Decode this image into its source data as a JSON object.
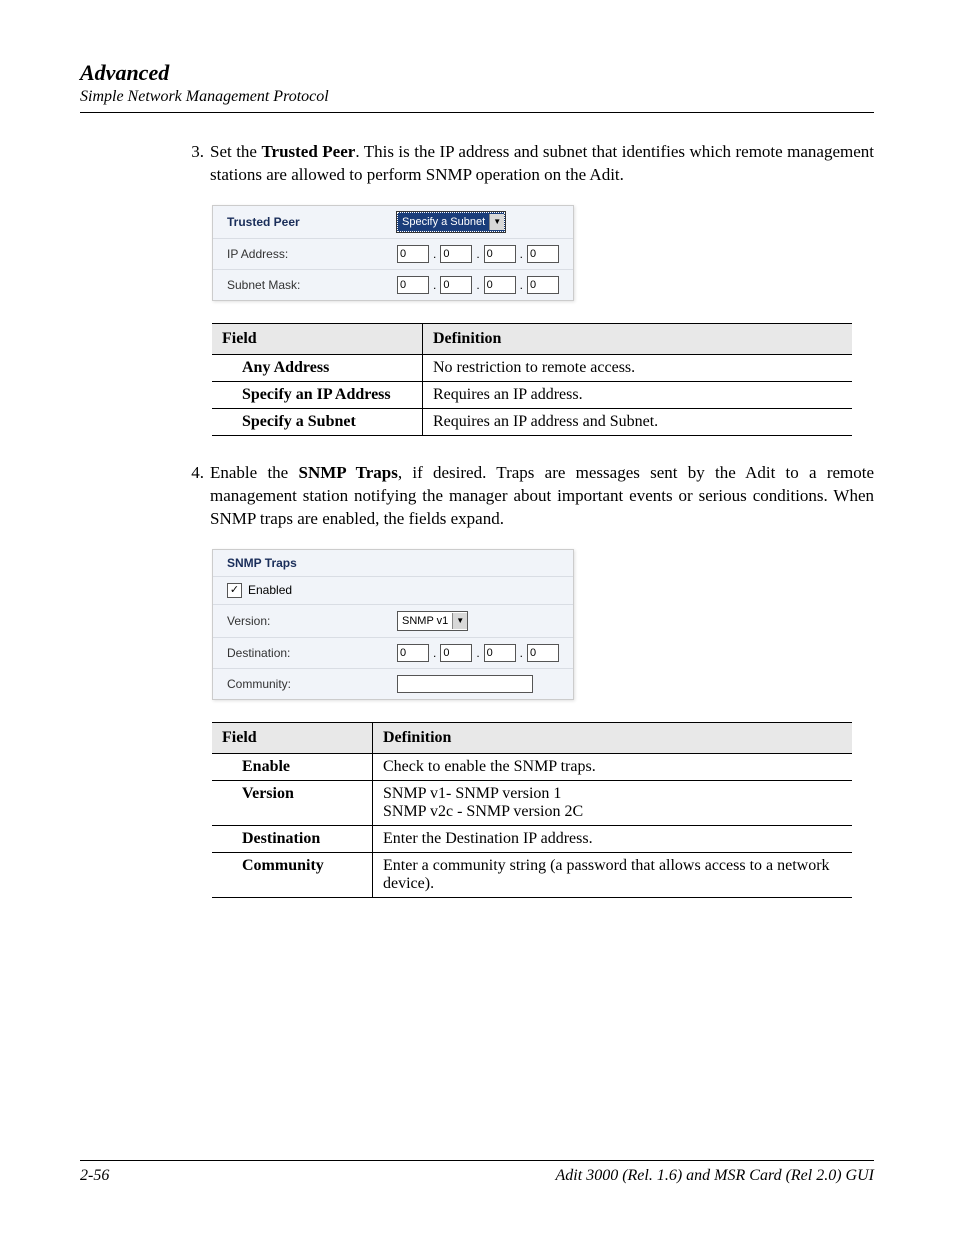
{
  "header": {
    "title": "Advanced",
    "subtitle": "Simple Network Management Protocol"
  },
  "step3": {
    "num": "3.",
    "pre": "Set the ",
    "bold": "Trusted Peer",
    "post": ". This is the IP address and subnet that identifies which remote management stations are allowed to perform SNMP operation on the Adit."
  },
  "panel1": {
    "trusted_peer_label": "Trusted Peer",
    "trusted_peer_value": "Specify a Subnet",
    "ip_label": "IP Address:",
    "subnet_label": "Subnet Mask:",
    "octets": [
      "0",
      "0",
      "0",
      "0"
    ],
    "subnet_octets": [
      "0",
      "0",
      "0",
      "0"
    ]
  },
  "table1": {
    "h1": "Field",
    "h2": "Definition",
    "rows": [
      {
        "f": "Any Address",
        "d": "No restriction to remote access."
      },
      {
        "f": "Specify an IP Address",
        "d": "Requires an IP address."
      },
      {
        "f": "Specify a Subnet",
        "d": "Requires an IP address and Subnet."
      }
    ]
  },
  "step4": {
    "num": "4.",
    "pre": "Enable the ",
    "bold": "SNMP Traps",
    "post": ", if desired. Traps are messages sent by the Adit to a remote management station notifying the manager about important events or serious conditions. When SNMP traps are enabled, the fields expand."
  },
  "panel2": {
    "title": "SNMP Traps",
    "enabled_label": "Enabled",
    "version_label": "Version:",
    "version_value": "SNMP v1",
    "destination_label": "Destination:",
    "dest_octets": [
      "0",
      "0",
      "0",
      "0"
    ],
    "community_label": "Community:",
    "community_value": ""
  },
  "table2": {
    "h1": "Field",
    "h2": "Definition",
    "rows": [
      {
        "f": "Enable",
        "d": "Check to enable the SNMP traps."
      },
      {
        "f": "Version",
        "d": "SNMP v1- SNMP version 1\nSNMP v2c - SNMP version 2C"
      },
      {
        "f": "Destination",
        "d": "Enter the Destination IP address."
      },
      {
        "f": "Community",
        "d": "Enter a community string (a password that allows access to a network device)."
      }
    ]
  },
  "footer": {
    "page": "2-56",
    "doc": "Adit 3000 (Rel. 1.6) and MSR Card (Rel 2.0) GUI"
  }
}
